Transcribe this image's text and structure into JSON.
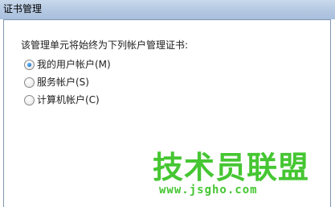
{
  "window": {
    "title": "证书管理"
  },
  "dialog": {
    "prompt": "该管理单元将始终为下列帐户管理证书:",
    "options": [
      {
        "label": "我的用户帐户(M)",
        "selected": true
      },
      {
        "label": "服务帐户(S)",
        "selected": false
      },
      {
        "label": "计算机帐户(C)",
        "selected": false
      }
    ]
  },
  "watermark": {
    "title": "技术员联盟",
    "url": "www.jsgho.com",
    "color": "#45c632"
  },
  "colors": {
    "title_bar": "#b4c8e2",
    "radio_selected": "#1c6fce"
  }
}
